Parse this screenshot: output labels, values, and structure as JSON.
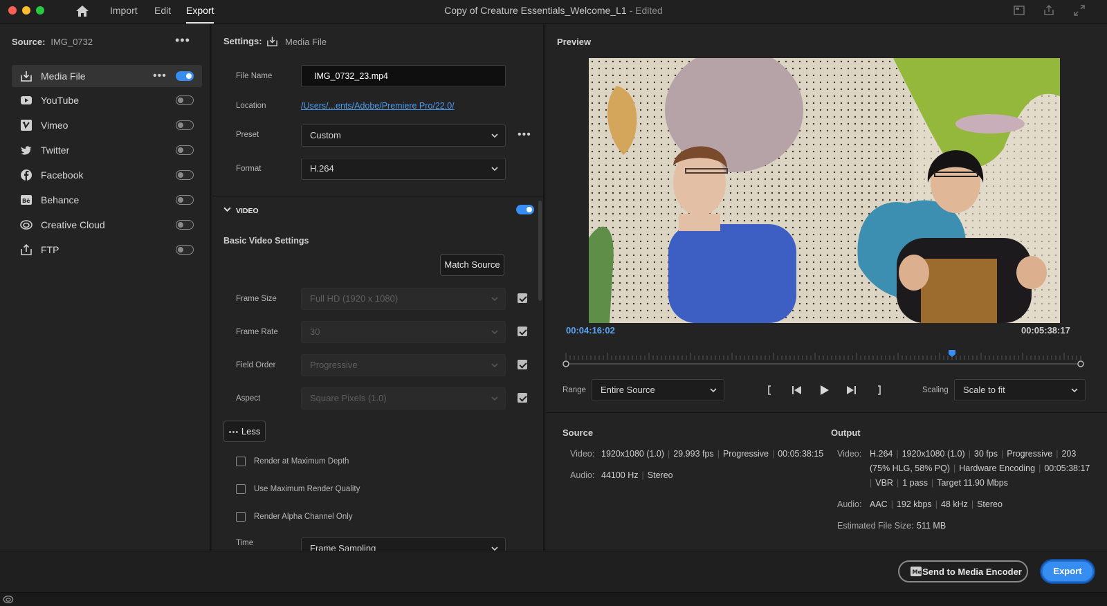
{
  "topbar": {
    "nav": [
      "Import",
      "Edit",
      "Export"
    ],
    "window_title": "Copy of Creature Essentials_Welcome_L1",
    "window_title_suffix": "- Edited"
  },
  "left": {
    "source_label": "Source:",
    "source_value": "IMG_0732",
    "destinations": [
      {
        "label": "Media File",
        "icon": "download-icon",
        "enabled": true,
        "selected": true
      },
      {
        "label": "YouTube",
        "icon": "youtube-icon",
        "enabled": false
      },
      {
        "label": "Vimeo",
        "icon": "vimeo-icon",
        "enabled": false
      },
      {
        "label": "Twitter",
        "icon": "twitter-icon",
        "enabled": false
      },
      {
        "label": "Facebook",
        "icon": "facebook-icon",
        "enabled": false
      },
      {
        "label": "Behance",
        "icon": "behance-icon",
        "enabled": false
      },
      {
        "label": "Creative Cloud",
        "icon": "creative-cloud-icon",
        "enabled": false
      },
      {
        "label": "FTP",
        "icon": "upload-icon",
        "enabled": false
      }
    ]
  },
  "settings": {
    "header_label": "Settings:",
    "header_value": "Media File",
    "file_name_label": "File Name",
    "file_name_value": "IMG_0732_23.mp4",
    "location_label": "Location",
    "location_value": "/Users/...ents/Adobe/Premiere Pro/22.0/",
    "preset_label": "Preset",
    "preset_value": "Custom",
    "format_label": "Format",
    "format_value": "H.264",
    "video_section": "VIDEO",
    "video_enabled": true,
    "basic_title": "Basic Video Settings",
    "match_source": "Match Source",
    "rows": [
      {
        "label": "Frame Size",
        "value": "Full HD (1920 x 1080)",
        "checked": true
      },
      {
        "label": "Frame Rate",
        "value": "30",
        "checked": true
      },
      {
        "label": "Field Order",
        "value": "Progressive",
        "checked": true
      },
      {
        "label": "Aspect",
        "value": "Square Pixels (1.0)",
        "checked": true
      }
    ],
    "less_button": "Less",
    "options": [
      {
        "label": "Render at Maximum Depth",
        "checked": false
      },
      {
        "label": "Use Maximum Render Quality",
        "checked": false
      },
      {
        "label": "Render Alpha Channel Only",
        "checked": false
      }
    ],
    "time_label": "Time",
    "time_value": "Frame Sampling"
  },
  "preview": {
    "title": "Preview",
    "timecode_in": "00:04:16:02",
    "timecode_out": "00:05:38:17",
    "playhead_fraction": 0.75,
    "range_label": "Range",
    "range_value": "Entire Source",
    "scaling_label": "Scaling",
    "scaling_value": "Scale to fit"
  },
  "source_info": {
    "title": "Source",
    "video_label": "Video:",
    "video_parts": [
      "1920x1080 (1.0)",
      "29.993 fps",
      "Progressive",
      "00:05:38:15"
    ],
    "audio_label": "Audio:",
    "audio_parts": [
      "44100 Hz",
      "Stereo"
    ]
  },
  "output_info": {
    "title": "Output",
    "video_label": "Video:",
    "video_line1": [
      "H.264",
      "1920x1080 (1.0)",
      "30 fps",
      "Progressive",
      "203"
    ],
    "video_line2": [
      "(75% HLG, 58% PQ)",
      "Hardware Encoding",
      "00:05:38:17"
    ],
    "video_line3": [
      "VBR",
      "1 pass",
      "Target 11.90 Mbps"
    ],
    "audio_label": "Audio:",
    "audio_parts": [
      "AAC",
      "192 kbps",
      "48 kHz",
      "Stereo"
    ],
    "size_label": "Estimated File Size:",
    "size_value": "511 MB"
  },
  "footer": {
    "send_button": "Send to Media Encoder",
    "export_button": "Export"
  },
  "colors": {
    "accent": "#378ef0",
    "timecode": "#5aa4f5",
    "link": "#4a9cf2"
  }
}
